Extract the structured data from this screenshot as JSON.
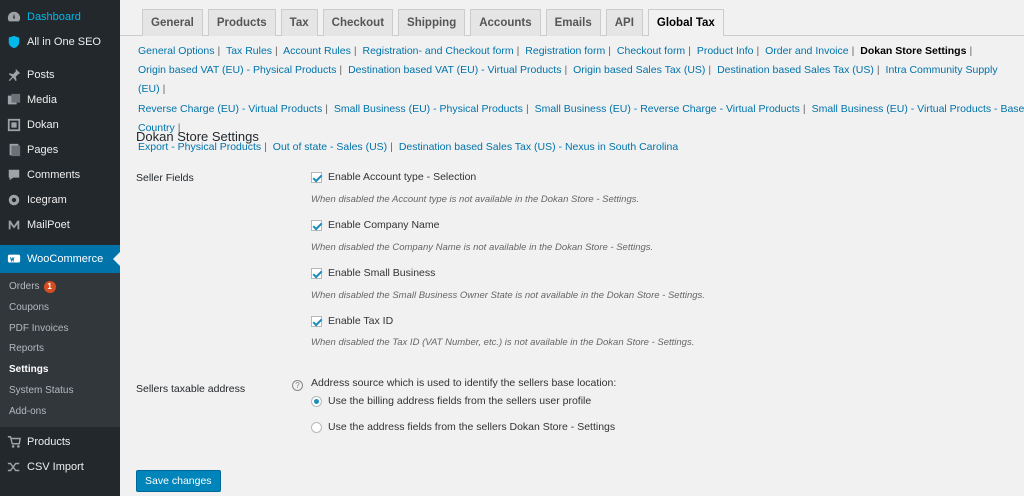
{
  "sidebar": {
    "top": [
      {
        "label": "Dashboard",
        "icon": "dashboard-icon"
      },
      {
        "label": "All in One SEO",
        "icon": "shield-icon"
      }
    ],
    "items": [
      {
        "label": "Posts",
        "icon": "pin-icon"
      },
      {
        "label": "Media",
        "icon": "media-icon"
      },
      {
        "label": "Dokan",
        "icon": "dokan-icon"
      },
      {
        "label": "Pages",
        "icon": "pages-icon"
      },
      {
        "label": "Comments",
        "icon": "comments-icon"
      },
      {
        "label": "Icegram",
        "icon": "icegram-icon"
      },
      {
        "label": "MailPoet",
        "icon": "mailpoet-icon"
      }
    ],
    "woocommerce": {
      "label": "WooCommerce",
      "icon": "woocommerce-icon"
    },
    "submenu": [
      {
        "label": "Orders",
        "badge": "1"
      },
      {
        "label": "Coupons"
      },
      {
        "label": "PDF Invoices"
      },
      {
        "label": "Reports"
      },
      {
        "label": "Settings"
      },
      {
        "label": "System Status"
      },
      {
        "label": "Add-ons"
      }
    ],
    "bottom": [
      {
        "label": "Products",
        "icon": "cart-icon"
      },
      {
        "label": "CSV Import",
        "icon": "shuffle-icon"
      }
    ]
  },
  "tabs": [
    "General",
    "Products",
    "Tax",
    "Checkout",
    "Shipping",
    "Accounts",
    "Emails",
    "API",
    "Global Tax"
  ],
  "active_tab": "Global Tax",
  "subnav": [
    "General Options",
    "Tax Rules",
    "Account Rules",
    "Registration- and Checkout form",
    "Registration form",
    "Checkout form",
    "Product Info",
    "Order and Invoice",
    "Dokan Store Settings",
    "Origin based VAT (EU) - Physical Products",
    "Destination based VAT (EU) - Virtual Products",
    "Origin based Sales Tax (US)",
    "Destination based Sales Tax (US)",
    "Intra Community Supply (EU)",
    "Reverse Charge (EU) - Virtual Products",
    "Small Business (EU) - Physical Products",
    "Small Business (EU) - Reverse Charge - Virtual Products",
    "Small Business (EU) - Virtual Products - Base Country",
    "Export - Physical Products",
    "Out of state - Sales (US)",
    "Destination based Sales Tax (US) - Nexus in South Carolina"
  ],
  "subnav_current": "Dokan Store Settings",
  "page_title": "Dokan Store Settings",
  "seller_fields": {
    "label": "Seller Fields",
    "options": [
      {
        "label": "Enable Account type - Selection",
        "checked": true,
        "desc": "When disabled the Account type is not available in the Dokan Store - Settings."
      },
      {
        "label": "Enable Company Name",
        "checked": true,
        "desc": "When disabled the Company Name is not available in the Dokan Store - Settings."
      },
      {
        "label": "Enable Small Business",
        "checked": true,
        "desc": "When disabled the Small Business Owner State is not available in the Dokan Store - Settings."
      },
      {
        "label": "Enable Tax ID",
        "checked": true,
        "desc": "When disabled the Tax ID (VAT Number, etc.) is not available in the Dokan Store - Settings."
      }
    ]
  },
  "taxable_address": {
    "label": "Sellers taxable address",
    "intro": "Address source which is used to identify the sellers base location:",
    "options": [
      {
        "label": "Use the billing address fields from the sellers user profile",
        "checked": true
      },
      {
        "label": "Use the address fields from the sellers Dokan Store - Settings",
        "checked": false
      }
    ]
  },
  "save_label": "Save changes"
}
